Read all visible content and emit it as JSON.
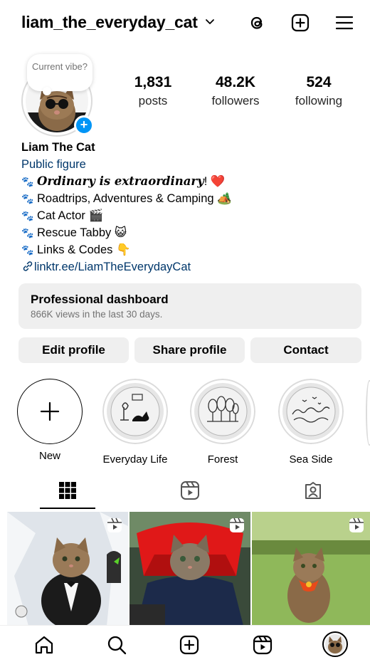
{
  "header": {
    "username": "liam_the_everyday_cat"
  },
  "profile": {
    "note_text": "Current vibe?",
    "stats": [
      {
        "value": "1,831",
        "label": "posts"
      },
      {
        "value": "48.2K",
        "label": "followers"
      },
      {
        "value": "524",
        "label": "following"
      }
    ],
    "name": "Liam The Cat",
    "category": "Public figure",
    "bio_lines": [
      {
        "emphasis": "Ordinary is extraordinary",
        "text": "! ❤️"
      },
      {
        "text": "Roadtrips, Adventures & Camping 🏕️"
      },
      {
        "text": "Cat Actor 🎬"
      },
      {
        "text": "Rescue Tabby 😺"
      },
      {
        "text": "Links & Codes 👇"
      }
    ],
    "link": "linktr.ee/LiamTheEverydayCat"
  },
  "dashboard": {
    "title": "Professional dashboard",
    "subtitle": "866K views in the last 30 days."
  },
  "buttons": {
    "edit": "Edit profile",
    "share": "Share profile",
    "contact": "Contact"
  },
  "highlights": [
    {
      "label": "New"
    },
    {
      "label": "Everyday Life"
    },
    {
      "label": "Forest"
    },
    {
      "label": "Sea Side"
    }
  ],
  "colors": {
    "accent_blue": "#0095f6",
    "link_blue": "#00376b",
    "button_bg": "#efefef",
    "secondary_text": "#737373"
  }
}
